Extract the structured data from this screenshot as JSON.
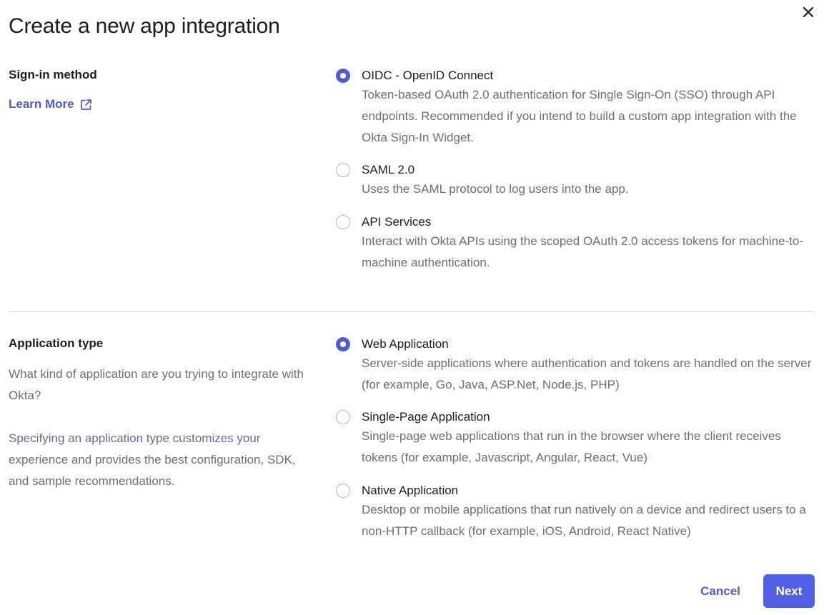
{
  "dialog": {
    "title": "Create a new app integration"
  },
  "sign_in": {
    "heading": "Sign-in method",
    "learn_more": "Learn More",
    "options": [
      {
        "label": "OIDC - OpenID Connect",
        "description": "Token-based OAuth 2.0 authentication for Single Sign-On (SSO) through API endpoints. Recommended if you intend to build a custom app integration with the Okta Sign-In Widget.",
        "selected": true
      },
      {
        "label": "SAML 2.0",
        "description": "Uses the SAML protocol to log users into the app.",
        "selected": false
      },
      {
        "label": "API Services",
        "description": "Interact with Okta APIs using the scoped OAuth 2.0 access tokens for machine-to-machine authentication.",
        "selected": false
      }
    ]
  },
  "app_type": {
    "heading": "Application type",
    "question": "What kind of application are you trying to integrate with Okta?",
    "explanation": "Specifying an application type customizes your experience and provides the best configuration, SDK, and sample recommendations.",
    "options": [
      {
        "label": "Web Application",
        "description": "Server-side applications where authentication and tokens are handled on the server (for example, Go, Java, ASP.Net, Node.js, PHP)",
        "selected": true
      },
      {
        "label": "Single-Page Application",
        "description": "Single-page web applications that run in the browser where the client receives tokens (for example, Javascript, Angular, React, Vue)",
        "selected": false
      },
      {
        "label": "Native Application",
        "description": "Desktop or mobile applications that run natively on a device and redirect users to a non-HTTP callback (for example, iOS, Android, React Native)",
        "selected": false
      }
    ]
  },
  "footer": {
    "cancel_label": "Cancel",
    "next_label": "Next"
  },
  "colors": {
    "accent": "#5260e5",
    "link": "#4f5bd5",
    "text": "#1d1d21",
    "muted": "#6e6e78",
    "divider": "#d7d7dc"
  },
  "icons": {
    "close": "close-icon",
    "external_link": "external-link-icon"
  }
}
